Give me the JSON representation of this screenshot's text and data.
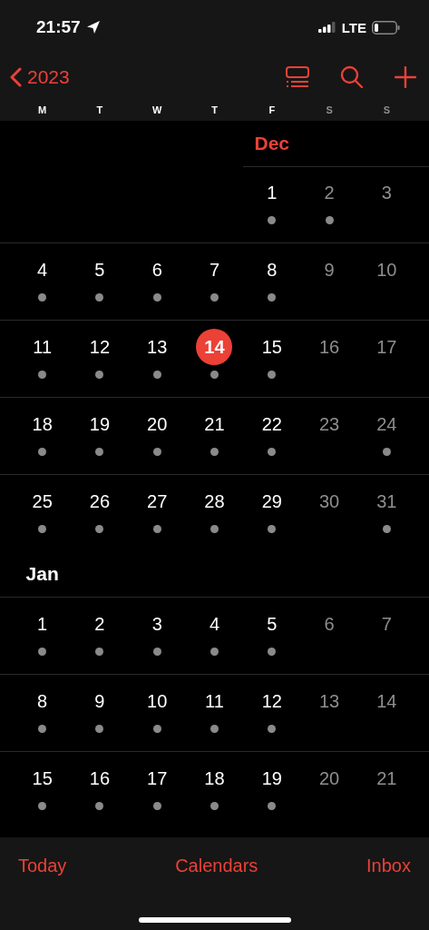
{
  "status_bar": {
    "time": "21:57",
    "network": "LTE"
  },
  "nav": {
    "back_label": "2023"
  },
  "weekdays": [
    {
      "label": "M",
      "weekend": false
    },
    {
      "label": "T",
      "weekend": false
    },
    {
      "label": "W",
      "weekend": false
    },
    {
      "label": "T",
      "weekend": false
    },
    {
      "label": "F",
      "weekend": false
    },
    {
      "label": "S",
      "weekend": true
    },
    {
      "label": "S",
      "weekend": true
    }
  ],
  "months": [
    {
      "name": "Dec",
      "weeks": [
        {
          "days": [
            {
              "kind": "blank"
            },
            {
              "kind": "blank"
            },
            {
              "kind": "blank"
            },
            {
              "kind": "blank"
            },
            {
              "kind": "day",
              "label": "1",
              "dot": true,
              "weekend": false,
              "today": false
            },
            {
              "kind": "day",
              "label": "2",
              "dot": true,
              "weekend": true,
              "today": false
            },
            {
              "kind": "day",
              "label": "3",
              "dot": false,
              "weekend": true,
              "today": false
            }
          ]
        },
        {
          "days": [
            {
              "kind": "day",
              "label": "4",
              "dot": true,
              "weekend": false,
              "today": false
            },
            {
              "kind": "day",
              "label": "5",
              "dot": true,
              "weekend": false,
              "today": false
            },
            {
              "kind": "day",
              "label": "6",
              "dot": true,
              "weekend": false,
              "today": false
            },
            {
              "kind": "day",
              "label": "7",
              "dot": true,
              "weekend": false,
              "today": false
            },
            {
              "kind": "day",
              "label": "8",
              "dot": true,
              "weekend": false,
              "today": false
            },
            {
              "kind": "day",
              "label": "9",
              "dot": false,
              "weekend": true,
              "today": false
            },
            {
              "kind": "day",
              "label": "10",
              "dot": false,
              "weekend": true,
              "today": false
            }
          ]
        },
        {
          "days": [
            {
              "kind": "day",
              "label": "11",
              "dot": true,
              "weekend": false,
              "today": false
            },
            {
              "kind": "day",
              "label": "12",
              "dot": true,
              "weekend": false,
              "today": false
            },
            {
              "kind": "day",
              "label": "13",
              "dot": true,
              "weekend": false,
              "today": false
            },
            {
              "kind": "day",
              "label": "14",
              "dot": true,
              "weekend": false,
              "today": true
            },
            {
              "kind": "day",
              "label": "15",
              "dot": true,
              "weekend": false,
              "today": false
            },
            {
              "kind": "day",
              "label": "16",
              "dot": false,
              "weekend": true,
              "today": false
            },
            {
              "kind": "day",
              "label": "17",
              "dot": false,
              "weekend": true,
              "today": false
            }
          ]
        },
        {
          "days": [
            {
              "kind": "day",
              "label": "18",
              "dot": true,
              "weekend": false,
              "today": false
            },
            {
              "kind": "day",
              "label": "19",
              "dot": true,
              "weekend": false,
              "today": false
            },
            {
              "kind": "day",
              "label": "20",
              "dot": true,
              "weekend": false,
              "today": false
            },
            {
              "kind": "day",
              "label": "21",
              "dot": true,
              "weekend": false,
              "today": false
            },
            {
              "kind": "day",
              "label": "22",
              "dot": true,
              "weekend": false,
              "today": false
            },
            {
              "kind": "day",
              "label": "23",
              "dot": false,
              "weekend": true,
              "today": false
            },
            {
              "kind": "day",
              "label": "24",
              "dot": true,
              "weekend": true,
              "today": false
            }
          ]
        },
        {
          "days": [
            {
              "kind": "day",
              "label": "25",
              "dot": true,
              "weekend": false,
              "today": false
            },
            {
              "kind": "day",
              "label": "26",
              "dot": true,
              "weekend": false,
              "today": false
            },
            {
              "kind": "day",
              "label": "27",
              "dot": true,
              "weekend": false,
              "today": false
            },
            {
              "kind": "day",
              "label": "28",
              "dot": true,
              "weekend": false,
              "today": false
            },
            {
              "kind": "day",
              "label": "29",
              "dot": true,
              "weekend": false,
              "today": false
            },
            {
              "kind": "day",
              "label": "30",
              "dot": false,
              "weekend": true,
              "today": false
            },
            {
              "kind": "day",
              "label": "31",
              "dot": true,
              "weekend": true,
              "today": false
            }
          ]
        }
      ]
    },
    {
      "name": "Jan",
      "weeks": [
        {
          "days": [
            {
              "kind": "day",
              "label": "1",
              "dot": true,
              "weekend": false,
              "today": false
            },
            {
              "kind": "day",
              "label": "2",
              "dot": true,
              "weekend": false,
              "today": false
            },
            {
              "kind": "day",
              "label": "3",
              "dot": true,
              "weekend": false,
              "today": false
            },
            {
              "kind": "day",
              "label": "4",
              "dot": true,
              "weekend": false,
              "today": false
            },
            {
              "kind": "day",
              "label": "5",
              "dot": true,
              "weekend": false,
              "today": false
            },
            {
              "kind": "day",
              "label": "6",
              "dot": false,
              "weekend": true,
              "today": false
            },
            {
              "kind": "day",
              "label": "7",
              "dot": false,
              "weekend": true,
              "today": false
            }
          ]
        },
        {
          "days": [
            {
              "kind": "day",
              "label": "8",
              "dot": true,
              "weekend": false,
              "today": false
            },
            {
              "kind": "day",
              "label": "9",
              "dot": true,
              "weekend": false,
              "today": false
            },
            {
              "kind": "day",
              "label": "10",
              "dot": true,
              "weekend": false,
              "today": false
            },
            {
              "kind": "day",
              "label": "11",
              "dot": true,
              "weekend": false,
              "today": false
            },
            {
              "kind": "day",
              "label": "12",
              "dot": true,
              "weekend": false,
              "today": false
            },
            {
              "kind": "day",
              "label": "13",
              "dot": false,
              "weekend": true,
              "today": false
            },
            {
              "kind": "day",
              "label": "14",
              "dot": false,
              "weekend": true,
              "today": false
            }
          ]
        },
        {
          "days": [
            {
              "kind": "day",
              "label": "15",
              "dot": true,
              "weekend": false,
              "today": false
            },
            {
              "kind": "day",
              "label": "16",
              "dot": true,
              "weekend": false,
              "today": false
            },
            {
              "kind": "day",
              "label": "17",
              "dot": true,
              "weekend": false,
              "today": false
            },
            {
              "kind": "day",
              "label": "18",
              "dot": true,
              "weekend": false,
              "today": false
            },
            {
              "kind": "day",
              "label": "19",
              "dot": true,
              "weekend": false,
              "today": false
            },
            {
              "kind": "day",
              "label": "20",
              "dot": false,
              "weekend": true,
              "today": false
            },
            {
              "kind": "day",
              "label": "21",
              "dot": false,
              "weekend": true,
              "today": false
            }
          ]
        }
      ]
    }
  ],
  "tab_bar": [
    "Today",
    "Calendars",
    "Inbox"
  ]
}
